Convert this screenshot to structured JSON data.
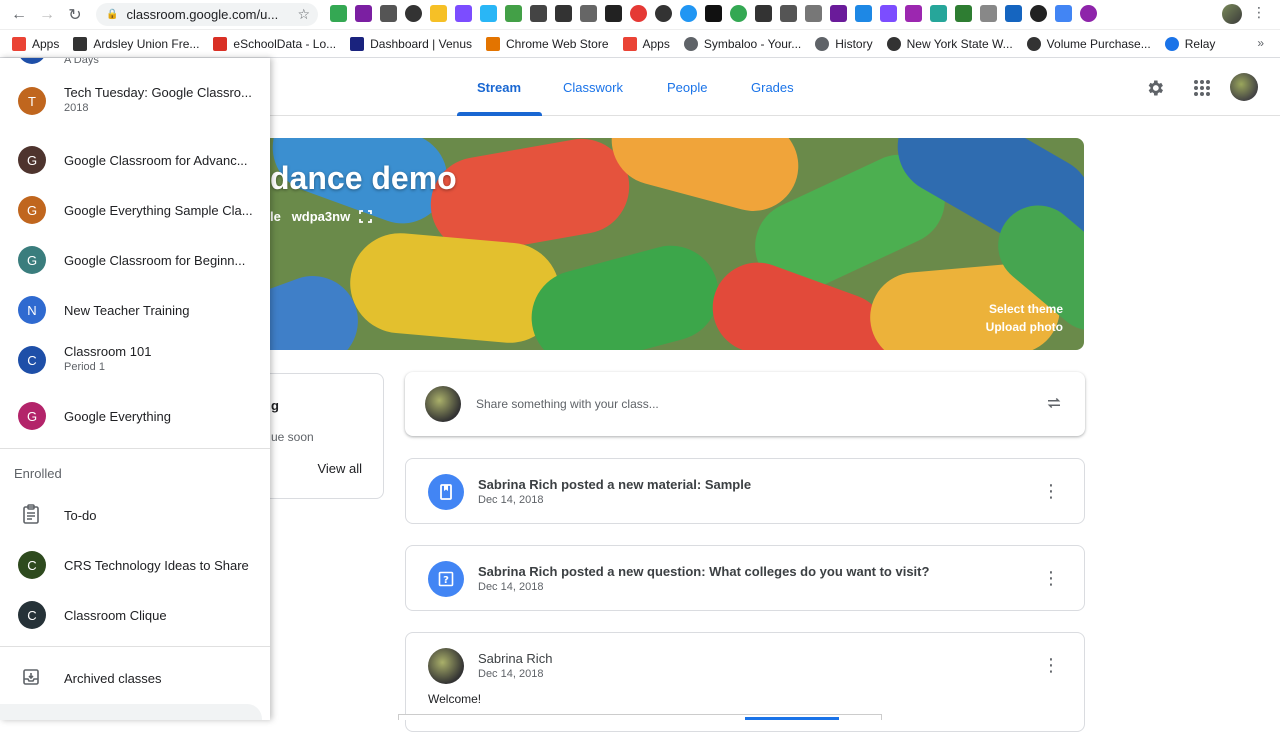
{
  "browser": {
    "url": "classroom.google.com/u...",
    "bookmarks": [
      {
        "label": "Apps",
        "icon": "apps-grid-icon",
        "color": "#ea4335"
      },
      {
        "label": "Ardsley Union Fre...",
        "icon": "school-icon",
        "color": "#333333"
      },
      {
        "label": "eSchoolData - Lo...",
        "icon": "esd-icon",
        "color": "#d93025"
      },
      {
        "label": "Dashboard | Venus",
        "icon": "play-icon",
        "color": "#1a237e"
      },
      {
        "label": "Chrome Web Store",
        "icon": "store-icon",
        "color": "#e37400"
      },
      {
        "label": "Apps",
        "icon": "apps-grid-icon",
        "color": "#ea4335"
      },
      {
        "label": "Symbaloo - Your...",
        "icon": "globe-icon",
        "color": "#5f6368"
      },
      {
        "label": "History",
        "icon": "history-icon",
        "color": "#5f6368"
      },
      {
        "label": "New York State W...",
        "icon": "globe-icon",
        "color": "#333333"
      },
      {
        "label": "Volume Purchase...",
        "icon": "globe-icon",
        "color": "#333333"
      },
      {
        "label": "Relay",
        "icon": "relay-icon",
        "color": "#1a73e8"
      }
    ]
  },
  "tabs": [
    {
      "label": "Stream",
      "active": true
    },
    {
      "label": "Classwork",
      "active": false
    },
    {
      "label": "People",
      "active": false
    },
    {
      "label": "Grades",
      "active": false
    }
  ],
  "banner": {
    "title": "dance demo",
    "code_prefix": "le",
    "class_code": "wdpa3nw",
    "select_theme": "Select theme",
    "upload_photo": "Upload photo"
  },
  "upcoming": {
    "title_fragment": "g",
    "subtitle_fragment": "ue soon",
    "view_all": "View all"
  },
  "share": {
    "placeholder": "Share something with your class..."
  },
  "posts": [
    {
      "title": "Sabrina Rich posted a new material: Sample",
      "date": "Dec 14, 2018",
      "icon": "material-icon"
    },
    {
      "title": "Sabrina Rich posted a new question: What colleges do you want to visit?",
      "date": "Dec 14, 2018",
      "icon": "question-icon"
    },
    {
      "author": "Sabrina Rich",
      "date": "Dec 14, 2018",
      "body": "Welcome!"
    }
  ],
  "drawer": {
    "top_fragment": "A Days",
    "teaching": [
      {
        "initial": "T",
        "label": "Tech Tuesday: Google Classro...",
        "sub": "2018",
        "color": "#c0661e"
      },
      {
        "initial": "G",
        "label": "Google Classroom for Advanc...",
        "sub": "",
        "color": "#4e342e"
      },
      {
        "initial": "G",
        "label": "Google Everything Sample Cla...",
        "sub": "",
        "color": "#c0661e"
      },
      {
        "initial": "G",
        "label": "Google Classroom for Beginn...",
        "sub": "",
        "color": "#3a7d7d"
      },
      {
        "initial": "N",
        "label": "New Teacher Training",
        "sub": "",
        "color": "#2f6ad0"
      },
      {
        "initial": "C",
        "label": "Classroom 101",
        "sub": "Period 1",
        "color": "#1e4fa8"
      },
      {
        "initial": "G",
        "label": "Google Everything",
        "sub": "",
        "color": "#b3246a"
      }
    ],
    "enrolled_label": "Enrolled",
    "todo_label": "To-do",
    "enrolled": [
      {
        "initial": "C",
        "label": "CRS Technology Ideas to Share",
        "color": "#2e4a1e"
      },
      {
        "initial": "C",
        "label": "Classroom Clique",
        "color": "#263238"
      }
    ],
    "archived_label": "Archived classes"
  }
}
